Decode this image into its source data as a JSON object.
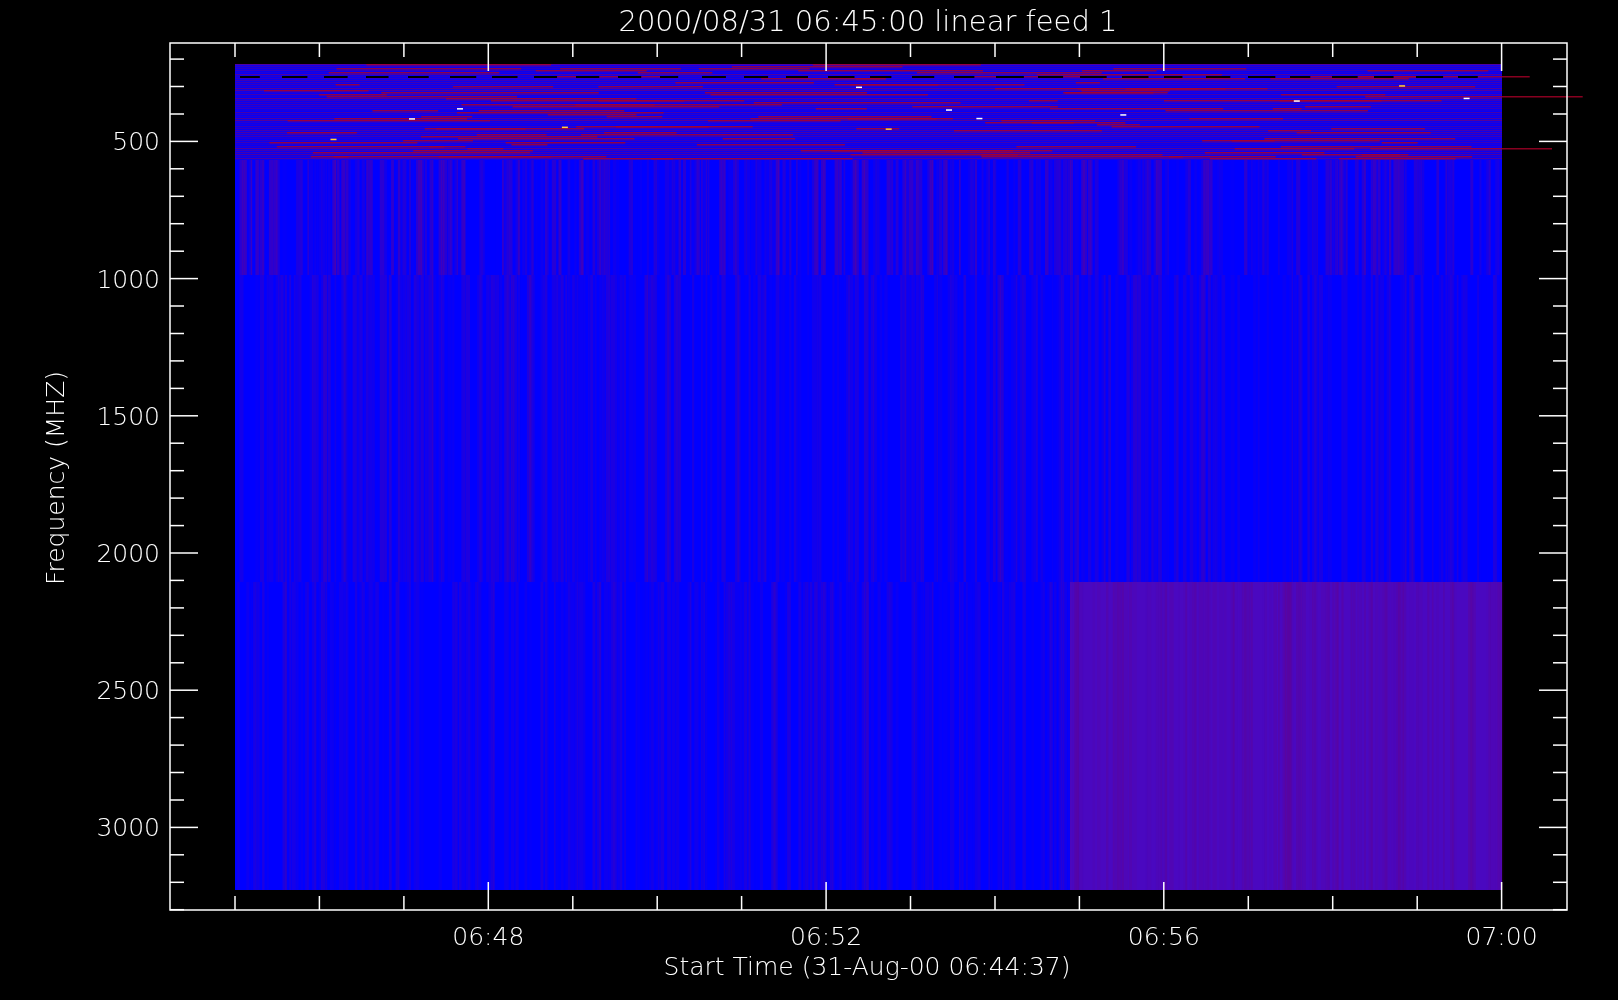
{
  "plot": {
    "title": "2000/08/31 06:45:00 linear feed 1",
    "ylabel": "Frequency (MHZ)",
    "xlabel": "Start Time (31-Aug-00 06:44:37)",
    "yticks": [
      "500",
      "1000",
      "1500",
      "2000",
      "2500",
      "3000"
    ],
    "xticks": [
      "06:48",
      "06:52",
      "06:56",
      "07:00"
    ]
  }
}
